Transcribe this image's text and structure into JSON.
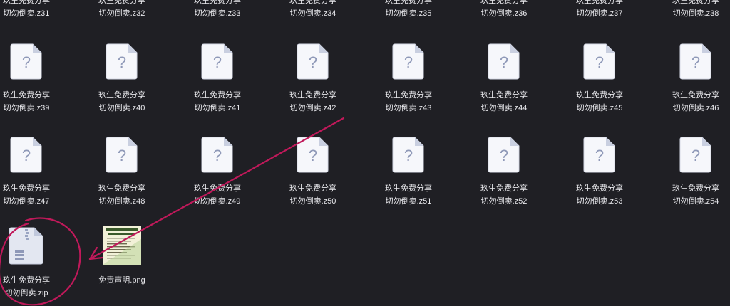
{
  "files": [
    {
      "line1": "玖生免费分享",
      "line2": "切勿倒卖.z31",
      "icon": "unknown-file-icon"
    },
    {
      "line1": "玖生免费分享",
      "line2": "切勿倒卖.z32",
      "icon": "unknown-file-icon"
    },
    {
      "line1": "玖生免费分享",
      "line2": "切勿倒卖.z33",
      "icon": "unknown-file-icon"
    },
    {
      "line1": "玖生免费分享",
      "line2": "切勿倒卖.z34",
      "icon": "unknown-file-icon"
    },
    {
      "line1": "玖生免费分享",
      "line2": "切勿倒卖.z35",
      "icon": "unknown-file-icon"
    },
    {
      "line1": "玖生免费分享",
      "line2": "切勿倒卖.z36",
      "icon": "unknown-file-icon"
    },
    {
      "line1": "玖生免费分享",
      "line2": "切勿倒卖.z37",
      "icon": "unknown-file-icon"
    },
    {
      "line1": "玖生免费分享",
      "line2": "切勿倒卖.z38",
      "icon": "unknown-file-icon"
    },
    {
      "line1": "玖生免费分享",
      "line2": "切勿倒卖.z39",
      "icon": "unknown-file-icon"
    },
    {
      "line1": "玖生免费分享",
      "line2": "切勿倒卖.z40",
      "icon": "unknown-file-icon"
    },
    {
      "line1": "玖生免费分享",
      "line2": "切勿倒卖.z41",
      "icon": "unknown-file-icon"
    },
    {
      "line1": "玖生免费分享",
      "line2": "切勿倒卖.z42",
      "icon": "unknown-file-icon"
    },
    {
      "line1": "玖生免费分享",
      "line2": "切勿倒卖.z43",
      "icon": "unknown-file-icon"
    },
    {
      "line1": "玖生免费分享",
      "line2": "切勿倒卖.z44",
      "icon": "unknown-file-icon"
    },
    {
      "line1": "玖生免费分享",
      "line2": "切勿倒卖.z45",
      "icon": "unknown-file-icon"
    },
    {
      "line1": "玖生免费分享",
      "line2": "切勿倒卖.z46",
      "icon": "unknown-file-icon"
    },
    {
      "line1": "玖生免费分享",
      "line2": "切勿倒卖.z47",
      "icon": "unknown-file-icon"
    },
    {
      "line1": "玖生免费分享",
      "line2": "切勿倒卖.z48",
      "icon": "unknown-file-icon"
    },
    {
      "line1": "玖生免费分享",
      "line2": "切勿倒卖.z49",
      "icon": "unknown-file-icon"
    },
    {
      "line1": "玖生免费分享",
      "line2": "切勿倒卖.z50",
      "icon": "unknown-file-icon"
    },
    {
      "line1": "玖生免费分享",
      "line2": "切勿倒卖.z51",
      "icon": "unknown-file-icon"
    },
    {
      "line1": "玖生免费分享",
      "line2": "切勿倒卖.z52",
      "icon": "unknown-file-icon"
    },
    {
      "line1": "玖生免费分享",
      "line2": "切勿倒卖.z53",
      "icon": "unknown-file-icon"
    },
    {
      "line1": "玖生免费分享",
      "line2": "切勿倒卖.z54",
      "icon": "unknown-file-icon"
    },
    {
      "line1": "玖生免费分享",
      "line2": "切勿倒卖.zip",
      "icon": "zip-archive-icon"
    },
    {
      "line1": "",
      "line2": "免责声明.png",
      "icon": "png-image-thumbnail"
    }
  ],
  "colors": {
    "background": "#1f1f24",
    "text": "#e8e8ec",
    "annotation": "#c0195a",
    "file_icon": "#f6f7fb",
    "file_icon_fold": "#c9cfe0",
    "file_icon_glyph": "#8f99b8"
  }
}
